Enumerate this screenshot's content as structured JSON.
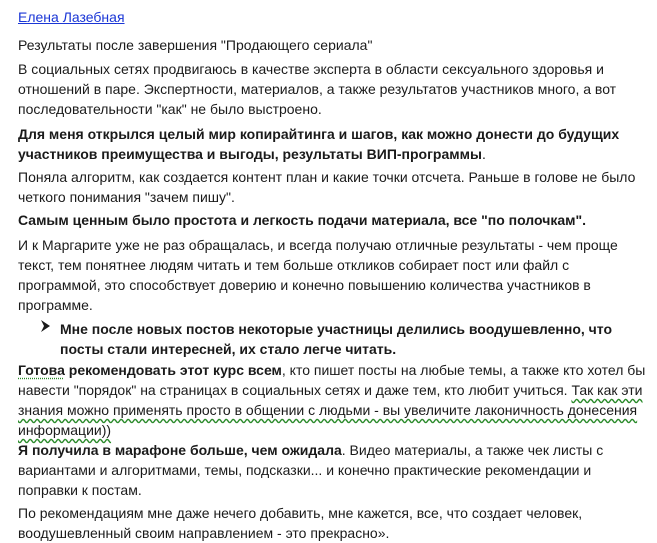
{
  "author": {
    "name": "Елена Лазебная"
  },
  "paragraphs": {
    "p1": "Результаты после завершения \"Продающего сериала\"",
    "p2": "В социальных сетях продвигаюсь в качестве эксперта в области сексуального здоровья и отношений в паре. Экспертности, материалов, а также результатов участников много, а вот последовательности \"как\" не было выстроено.",
    "p3": "Для меня открылся целый мир копирайтинга и шагов, как можно донести до будущих участников преимущества и выгоды, результаты ВИП-программы",
    "p3_end": ".",
    "p4": "Поняла алгоритм, как создается контент план и какие точки отсчета. Раньше в голове не было четкого понимания \"зачем пишу\".",
    "p5": "Самым ценным было простота и легкость подачи материала, все \"по полочкам\".",
    "p6": "И к Маргарите уже не раз обращалась, и всегда получаю отличные результаты - чем проще текст, тем понятнее людям читать и тем больше откликов собирает пост или файл с программой, это способствует доверию и конечно повышению количества участников в программе.",
    "bullet": "Мне после новых постов некоторые участницы делились воодушевленно, что посты стали интересней, их стало легче читать.",
    "p8_bold1": "Готова",
    "p8_bold2": "рекомендовать этот курс всем",
    "p8_rest": ", кто пишет посты на любые темы, а также кто хотел бы навести \"порядок\" на страницах в социальных сетях и даже тем, кто любит учиться. ",
    "p8_wavy": "Так как эти знания можно применять просто в общении с людьми - вы увеличите лаконичность донесения информации))",
    "p9_bold": "Я получила в марафоне больше, чем ожидала",
    "p9_rest": ". Видео материалы, а также чек листы с вариантами и алгоритмами, темы, подсказки... и конечно практические рекомендации и поправки к постам.",
    "p10": "По рекомендациям мне даже нечего добавить, мне кажется, все, что создает человек, воодушевленный своим направлением - это прекрасно»."
  },
  "icons": {
    "bullet": "arrow-bullet-icon"
  }
}
